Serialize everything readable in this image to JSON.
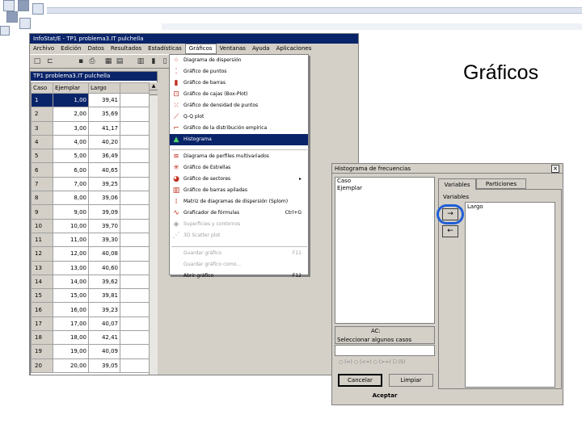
{
  "slide": {
    "title": "Gráficos"
  },
  "app": {
    "title": "InfoStat/E - TP1 problema3.IT pulchella",
    "menubar": [
      "Archivo",
      "Edición",
      "Datos",
      "Resultados",
      "Estadísticas",
      "Gráficos",
      "Ventanas",
      "Ayuda",
      "Aplicaciones"
    ],
    "active_menu_index": 5
  },
  "datawin": {
    "title": "TP1 problema3.IT pulchella",
    "columns": [
      "Caso",
      "Ejemplar",
      "Largo"
    ],
    "rows": [
      {
        "caso": "1",
        "ejemplar": "1,00",
        "largo": "39,41"
      },
      {
        "caso": "2",
        "ejemplar": "2,00",
        "largo": "35,69"
      },
      {
        "caso": "3",
        "ejemplar": "3,00",
        "largo": "41,17"
      },
      {
        "caso": "4",
        "ejemplar": "4,00",
        "largo": "40,20"
      },
      {
        "caso": "5",
        "ejemplar": "5,00",
        "largo": "36,49"
      },
      {
        "caso": "6",
        "ejemplar": "6,00",
        "largo": "40,65"
      },
      {
        "caso": "7",
        "ejemplar": "7,00",
        "largo": "39,25"
      },
      {
        "caso": "8",
        "ejemplar": "8,00",
        "largo": "39,06"
      },
      {
        "caso": "9",
        "ejemplar": "9,00",
        "largo": "39,09"
      },
      {
        "caso": "10",
        "ejemplar": "10,00",
        "largo": "39,70"
      },
      {
        "caso": "11",
        "ejemplar": "11,00",
        "largo": "39,30"
      },
      {
        "caso": "12",
        "ejemplar": "12,00",
        "largo": "40,08"
      },
      {
        "caso": "13",
        "ejemplar": "13,00",
        "largo": "40,60"
      },
      {
        "caso": "14",
        "ejemplar": "14,00",
        "largo": "39,62"
      },
      {
        "caso": "15",
        "ejemplar": "15,00",
        "largo": "39,81"
      },
      {
        "caso": "16",
        "ejemplar": "16,00",
        "largo": "39,23"
      },
      {
        "caso": "17",
        "ejemplar": "17,00",
        "largo": "40,07"
      },
      {
        "caso": "18",
        "ejemplar": "18,00",
        "largo": "42,41"
      },
      {
        "caso": "19",
        "ejemplar": "19,00",
        "largo": "40,09"
      },
      {
        "caso": "20",
        "ejemplar": "20,00",
        "largo": "39,05"
      }
    ]
  },
  "menu": {
    "items": [
      {
        "label": "Diagrama de dispersión",
        "icon": "scatter-icon",
        "shortcut": "",
        "state": "normal"
      },
      {
        "label": "Gráfico de puntos",
        "icon": "dot-plot-icon",
        "shortcut": "",
        "state": "normal"
      },
      {
        "label": "Gráfico de barras",
        "icon": "bar-chart-icon",
        "shortcut": "",
        "state": "normal"
      },
      {
        "label": "Gráfico de cajas (Box-Plot)",
        "icon": "box-plot-icon",
        "shortcut": "",
        "state": "normal"
      },
      {
        "label": "Gráfico de densidad de puntos",
        "icon": "density-icon",
        "shortcut": "",
        "state": "normal"
      },
      {
        "label": "Q-Q plot",
        "icon": "qq-plot-icon",
        "shortcut": "",
        "state": "normal"
      },
      {
        "label": "Gráfico de la distribución empírica",
        "icon": "empirical-icon",
        "shortcut": "",
        "state": "normal"
      },
      {
        "label": "Histograma",
        "icon": "histogram-icon",
        "shortcut": "",
        "state": "highlight"
      },
      {
        "label": "Diagrama de perfiles multivariados",
        "icon": "profile-icon",
        "shortcut": "",
        "state": "normal"
      },
      {
        "label": "Gráfico de Estrellas",
        "icon": "star-icon",
        "shortcut": "",
        "state": "normal"
      },
      {
        "label": "Gráfico de sectores",
        "icon": "pie-icon",
        "shortcut": "▸",
        "state": "normal"
      },
      {
        "label": "Gráfico de barras apiladas",
        "icon": "stacked-bar-icon",
        "shortcut": "",
        "state": "normal"
      },
      {
        "label": "Matriz de diagramas de dispersión (Splom)",
        "icon": "matrix-icon",
        "shortcut": "",
        "state": "normal"
      },
      {
        "label": "Graficador de fórmulas",
        "icon": "formula-icon",
        "shortcut": "Ctrl+G",
        "state": "normal"
      },
      {
        "label": "Superficies y contornos",
        "icon": "surface-icon",
        "shortcut": "",
        "state": "disabled"
      },
      {
        "label": "3D Scatter plot",
        "icon": "scatter-3d-icon",
        "shortcut": "",
        "state": "disabled"
      },
      {
        "label": "Guardar gráfico",
        "icon": "",
        "shortcut": "F11",
        "state": "disabled"
      },
      {
        "label": "Guardar gráfico como...",
        "icon": "",
        "shortcut": "",
        "state": "disabled"
      },
      {
        "label": "Abrir gráfico",
        "icon": "",
        "shortcut": "F12",
        "state": "normal"
      }
    ]
  },
  "dialog": {
    "title": "Histograma de frecuencias",
    "left_list": [
      "Caso",
      "Ejemplar"
    ],
    "tabs": [
      "Variables",
      "Particiones"
    ],
    "group_label": "Variables",
    "selected_vars": [
      "Largo"
    ],
    "add_arrow": "→",
    "remove_arrow": "←",
    "select_cases_label": "Seleccionar algunos casos",
    "select_cases_prefix": "AC:",
    "checks": [
      "(=)",
      "(<=)",
      "(>=)",
      "(S)"
    ],
    "cancel": "Cancelar",
    "clear": "Limpiar",
    "ok": "Aceptar"
  }
}
